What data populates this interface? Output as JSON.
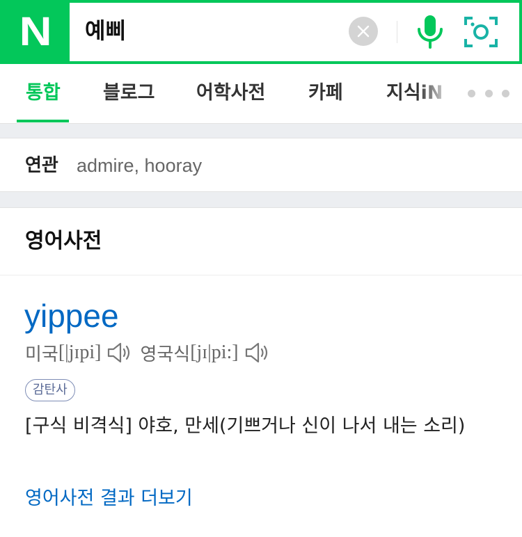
{
  "brand": {
    "logo_letter": "N",
    "color": "#03c75a"
  },
  "search": {
    "query": "예삐"
  },
  "icons": {
    "clear": "close-icon",
    "voice": "microphone-icon",
    "lens": "camera-lens-icon",
    "more": "more-dots-icon",
    "speaker": "speaker-icon"
  },
  "tabs": [
    {
      "label": "통합",
      "active": true
    },
    {
      "label": "블로그"
    },
    {
      "label": "어학사전"
    },
    {
      "label": "카페"
    },
    {
      "label": "지식iN"
    }
  ],
  "related": {
    "label": "연관",
    "terms": "admire, hooray"
  },
  "dictionary": {
    "section_title": "영어사전",
    "word": "yippee",
    "us": {
      "label": "미국",
      "pron": "[|jɪpi]"
    },
    "uk": {
      "label": "영국식",
      "pron": "[jɪ|pi:]"
    },
    "pos": "감탄사",
    "meaning": "[구식 비격식] 야호, 만세(기쁘거나 신이 나서 내는 소리)",
    "more_link": "영어사전 결과 더보기",
    "link_color": "#0068c3"
  }
}
